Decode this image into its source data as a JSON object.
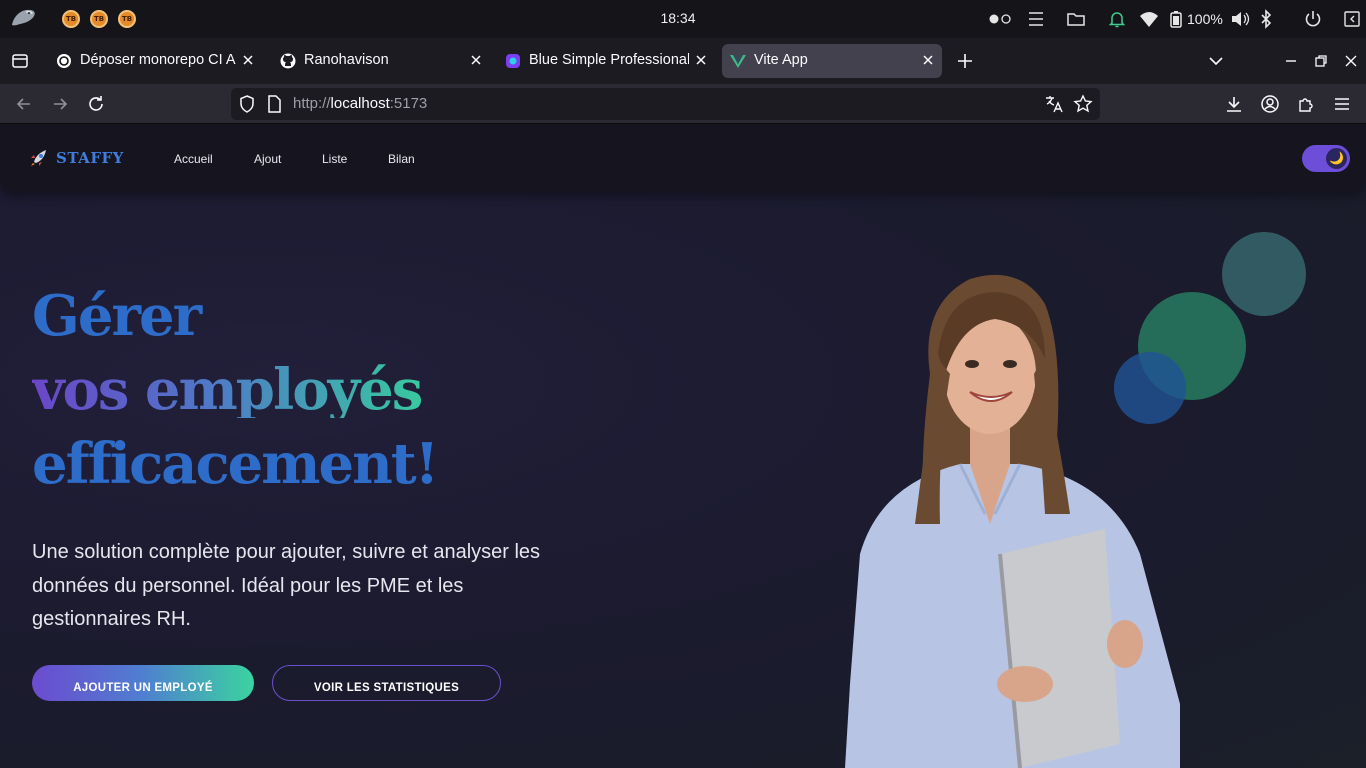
{
  "os": {
    "clock": "18:34",
    "battery": "100%",
    "tray_apps": [
      "TB",
      "TB",
      "TB"
    ]
  },
  "browser": {
    "tabs": [
      {
        "title": "Déposer monorepo CI A",
        "active": false,
        "favicon": "openai-icon"
      },
      {
        "title": "Ranohavison",
        "active": false,
        "favicon": "github-icon"
      },
      {
        "title": "Blue Simple Professional",
        "active": false,
        "favicon": "canva-icon"
      },
      {
        "title": "Vite App",
        "active": true,
        "favicon": "vue-icon"
      }
    ],
    "url": {
      "scheme": "http://",
      "host": "localhost",
      "port": ":5173"
    }
  },
  "site": {
    "brand": "STAFFY",
    "nav": [
      "Accueil",
      "Ajout",
      "Liste",
      "Bilan"
    ],
    "theme_toggle_icon": "🌙",
    "hero": {
      "line1": "Gérer",
      "line2": "vos employés",
      "line3": "efficacement!",
      "subtitle": "Une solution complète pour ajouter, suivre et analyser les données du personnel. Idéal pour les PME et les gestionnaires RH.",
      "primary_button": "AJOUTER UN EMPLOYÉ",
      "secondary_button": "VOIR LES STATISTIQUES"
    }
  },
  "colors": {
    "brand_blue": "#2d6cc9",
    "accent_purple": "#6c4bd0",
    "accent_green": "#3bd3a0",
    "browser_chrome": "#2b2a33"
  }
}
